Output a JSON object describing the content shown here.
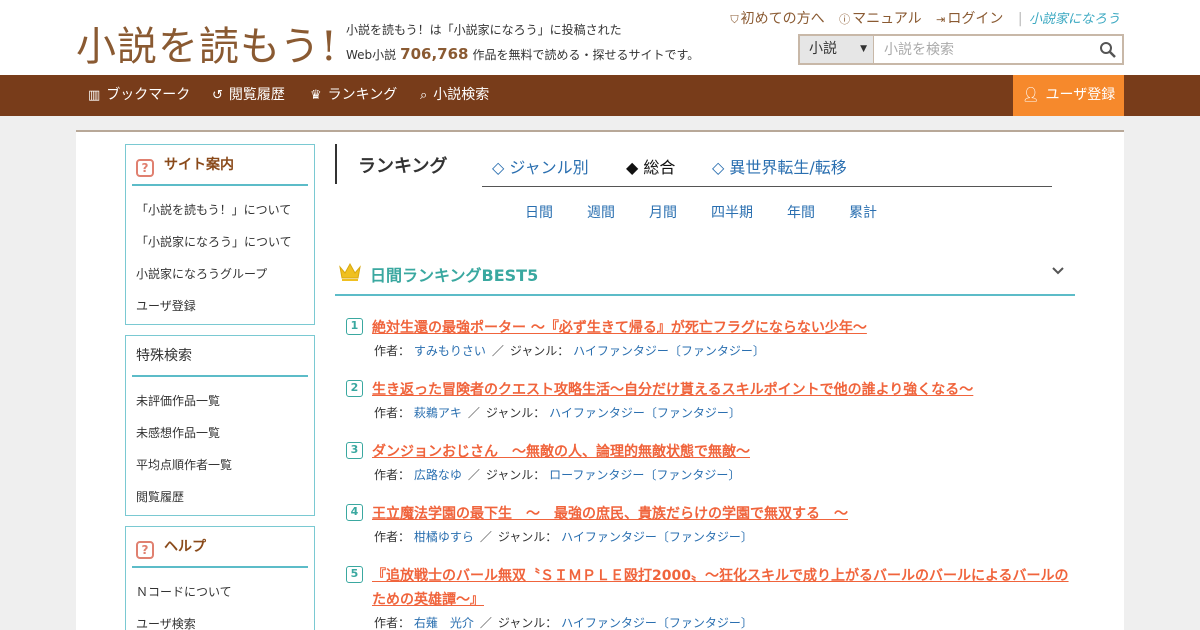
{
  "header": {
    "logo_text": "小説を読もう!",
    "desc_line1": "小説を読もう！は「小説家になろう」に投稿された",
    "desc_prefix": "Web小説",
    "work_count": "706,768",
    "desc_suffix": "作品を無料で読める・探せるサイトです。",
    "links": [
      "初めての方へ",
      "マニュアル",
      "ログイン"
    ],
    "brand_link": "小説家になろう",
    "search": {
      "type_selected": "小説",
      "placeholder": "小説を検索"
    }
  },
  "nav": {
    "items": [
      "ブックマーク",
      "閲覧履歴",
      "ランキング",
      "小説検索"
    ],
    "register": "ユーザ登録"
  },
  "sidebar": {
    "site_info": {
      "title": "サイト案内",
      "items": [
        "「小説を読もう！」について",
        "「小説家になろう」について",
        "小説家になろうグループ",
        "ユーザ登録"
      ]
    },
    "special_search": {
      "title": "特殊検索",
      "items": [
        "未評価作品一覧",
        "未感想作品一覧",
        "平均点順作者一覧",
        "閲覧履歴"
      ]
    },
    "help": {
      "title": "ヘルプ",
      "items": [
        "Ｎコードについて",
        "ユーザ検索"
      ]
    }
  },
  "ranking": {
    "title": "ランキング",
    "tabs": [
      "◇ ジャンル別",
      "◆ 総合",
      "◇ 異世界転生/転移"
    ],
    "periods": [
      "日間",
      "週間",
      "月間",
      "四半期",
      "年間",
      "累計"
    ],
    "section_title": "日間ランキングBEST5",
    "author_label": "作者：",
    "genre_label": "ジャンル：",
    "entries": [
      {
        "rank": "1",
        "title": "絶対生還の最強ポーター ～『必ず生きて帰る』が死亡フラグにならない少年～",
        "author": "すみもりさい",
        "genre": "ハイファンタジー〔ファンタジー〕"
      },
      {
        "rank": "2",
        "title": "生き返った冒険者のクエスト攻略生活～自分だけ貰えるスキルポイントで他の誰より強くなる～",
        "author": "萩鵜アキ",
        "genre": "ハイファンタジー〔ファンタジー〕"
      },
      {
        "rank": "3",
        "title": "ダンジョンおじさん　～無敵の人、論理的無敵状態で無敵～",
        "author": "広路なゆ",
        "genre": "ローファンタジー〔ファンタジー〕"
      },
      {
        "rank": "4",
        "title": "王立魔法学園の最下生　～　最強の庶民、貴族だらけの学園で無双する　～",
        "author": "柑橘ゆすら",
        "genre": "ハイファンタジー〔ファンタジー〕"
      },
      {
        "rank": "5",
        "title": "『追放戦士のバール無双〝ＳＩＭＰＬＥ殴打2000〟～狂化スキルで成り上がるバールのバールによるバールのための英雄譚～』",
        "author": "右薙　光介",
        "genre": "ハイファンタジー〔ファンタジー〕"
      }
    ]
  }
}
